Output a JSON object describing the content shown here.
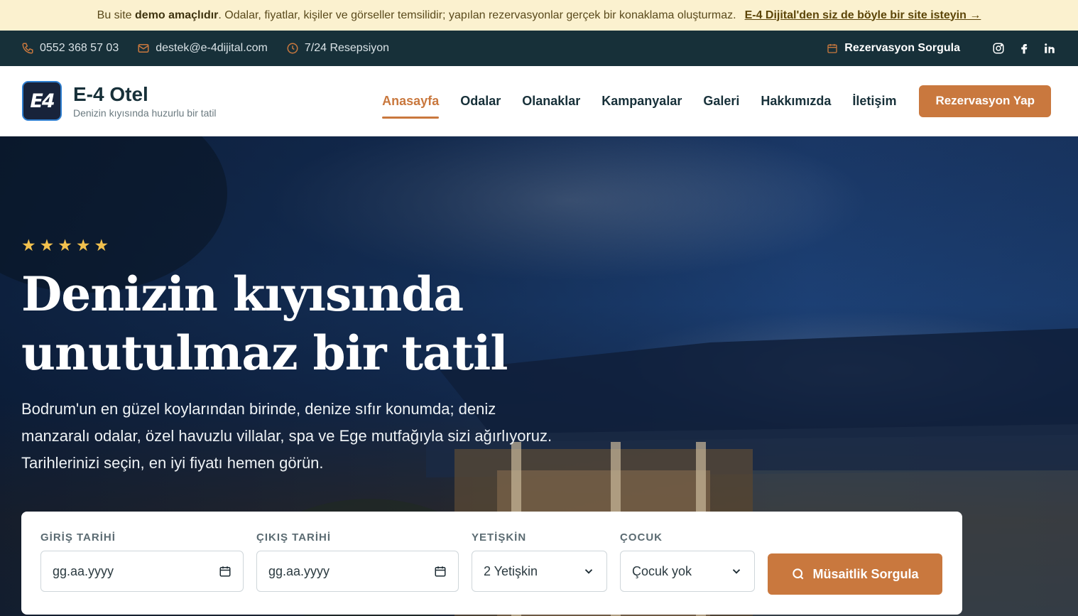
{
  "demo_bar": {
    "prefix": "Bu site",
    "bold": "demo amaçlıdır",
    "rest": ". Odalar, fiyatlar, kişiler ve görseller temsilidir; yapılan rezervasyonlar gerçek bir konaklama oluşturmaz.",
    "link": "E-4 Dijital'den siz de böyle bir site isteyin →"
  },
  "contact_bar": {
    "phone": "0552 368 57 03",
    "email": "destek@e-4dijital.com",
    "reception": "7/24 Resepsiyon",
    "reservation_check": "Rezervasyon Sorgula",
    "social": [
      "instagram-icon",
      "facebook-icon",
      "linkedin-icon"
    ]
  },
  "header": {
    "logo_text": "E4",
    "brand_name": "E-4 Otel",
    "tagline": "Denizin kıyısında huzurlu bir tatil",
    "nav": [
      {
        "label": "Anasayfa",
        "active": true
      },
      {
        "label": "Odalar"
      },
      {
        "label": "Olanaklar"
      },
      {
        "label": "Kampanyalar"
      },
      {
        "label": "Galeri"
      },
      {
        "label": "Hakkımızda"
      },
      {
        "label": "İletişim"
      }
    ],
    "cta": "Rezervasyon Yap"
  },
  "hero": {
    "stars": 5,
    "title_line1": "Denizin kıyısında",
    "title_line2": "unutulmaz bir tatil",
    "description": "Bodrum'un en güzel koylarından birinde, denize sıfır konumda; deniz manzaralı odalar, özel havuzlu villalar, spa ve Ege mutfağıyla sizi ağırlıyoruz. Tarihlerinizi seçin, en iyi fiyatı hemen görün."
  },
  "booking": {
    "checkin_label": "GİRİŞ TARİHİ",
    "checkin_value": "gg.aa.yyyy",
    "checkout_label": "ÇIKIŞ TARİHİ",
    "checkout_value": "gg.aa.yyyy",
    "adults_label": "YETİŞKİN",
    "adults_value": "2 Yetişkin",
    "children_label": "ÇOCUK",
    "children_value": "Çocuk yok",
    "search_button": "Müsaitlik Sorgula"
  },
  "colors": {
    "accent": "#c9783e",
    "dark": "#173039",
    "demo_bg": "#fbf1cf",
    "star": "#f2c14e"
  }
}
